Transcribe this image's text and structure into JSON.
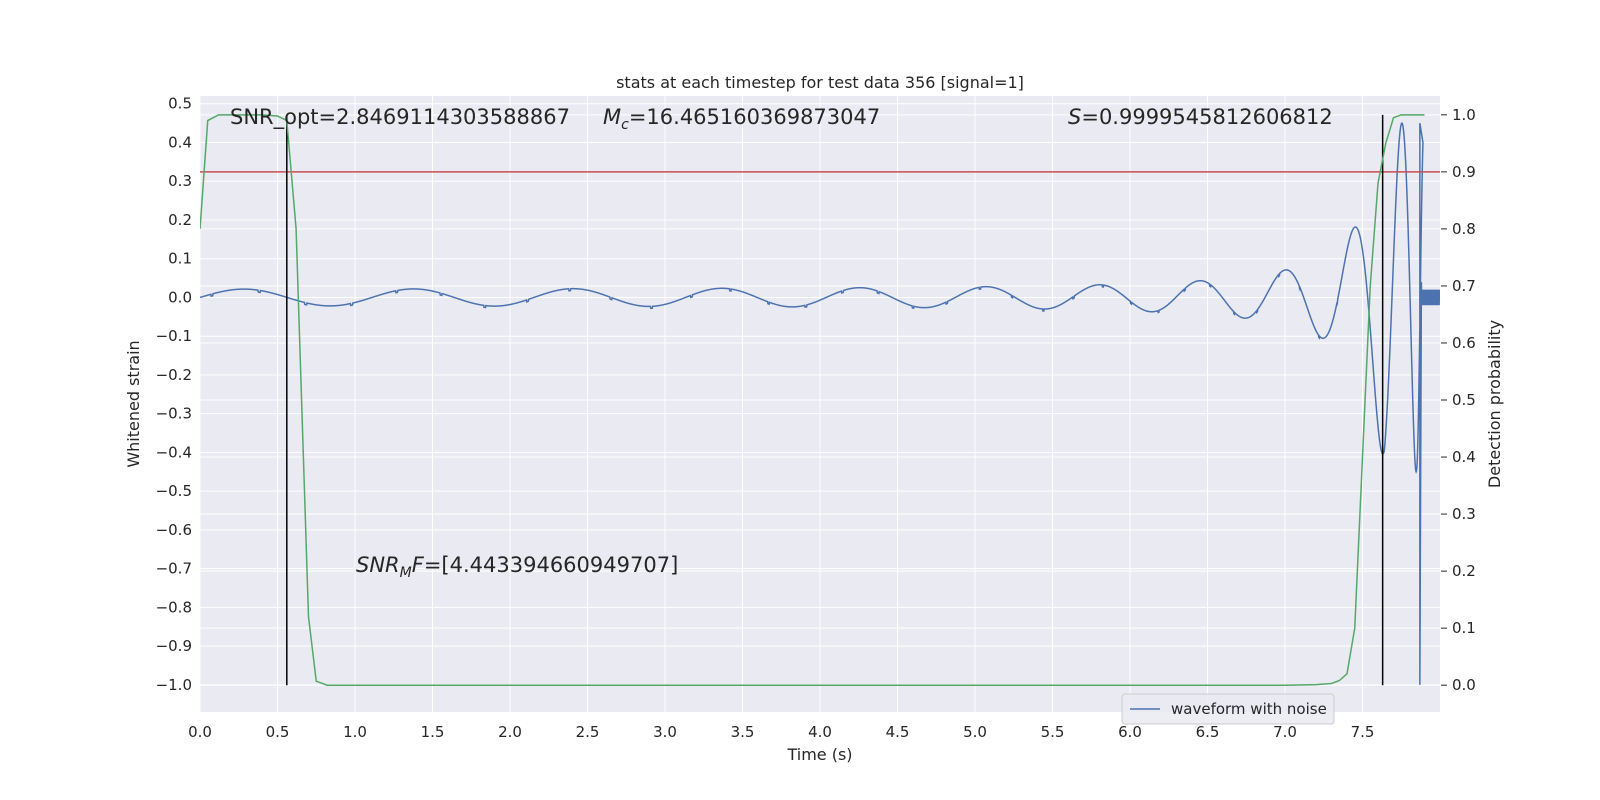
{
  "chart_data": {
    "type": "line",
    "title": "stats at each timestep for test data 356 [signal=1]",
    "xlabel": "Time (s)",
    "ylabel": "Whitened strain",
    "y2label": "Detection probability",
    "xlim": [
      0.0,
      8.0
    ],
    "ylim": [
      -1.07,
      0.52
    ],
    "y2lim": [
      -0.047,
      1.033
    ],
    "xticks": [
      "0.0",
      "0.5",
      "1.0",
      "1.5",
      "2.0",
      "2.5",
      "3.0",
      "3.5",
      "4.0",
      "4.5",
      "5.0",
      "5.5",
      "6.0",
      "6.5",
      "7.0",
      "7.5"
    ],
    "yticks": [
      "0.5",
      "0.4",
      "0.3",
      "0.2",
      "0.1",
      "0.0",
      "−0.1",
      "−0.2",
      "−0.3",
      "−0.4",
      "−0.5",
      "−0.6",
      "−0.7",
      "−0.8",
      "−0.9",
      "−1.0"
    ],
    "y2ticks": [
      "1.0",
      "0.9",
      "0.8",
      "0.7",
      "0.6",
      "0.5",
      "0.4",
      "0.3",
      "0.2",
      "0.1",
      "0.0"
    ],
    "grid": true,
    "legend_placement": "lower-right",
    "annotations": {
      "snr_opt": "SNR_opt=2.8469114303588867",
      "mc_symbol": "M",
      "mc_sub": "c",
      "mc_value": "=16.465160369873047",
      "s_symbol": "S",
      "s_value": "=0.9999545812606812",
      "snrmf_symbol": "SNR",
      "snrmf_sub": "M",
      "snrmf_tail": "F",
      "snrmf_value": "=[4.443394660949707]"
    },
    "series": [
      {
        "name": "waveform with noise",
        "axis": "left",
        "color": "#4c72b0",
        "kind": "chirp",
        "t_start": 0.0,
        "t_end": 7.89,
        "merger_time": 7.87,
        "early_amplitude": 0.02,
        "peak_amplitude": 0.45,
        "end_min": -1.0
      },
      {
        "axis": "right",
        "color": "#55a868",
        "x": [
          0.0,
          0.05,
          0.12,
          0.2,
          0.3,
          0.4,
          0.5,
          0.56,
          0.62,
          0.7,
          0.75,
          0.82,
          1.0,
          2.0,
          3.0,
          4.0,
          5.0,
          6.0,
          7.0,
          7.2,
          7.3,
          7.35,
          7.4,
          7.45,
          7.5,
          7.55,
          7.6,
          7.65,
          7.7,
          7.75,
          7.8,
          7.9
        ],
        "values": [
          0.8,
          0.99,
          1.0,
          1.0,
          1.0,
          1.0,
          0.998,
          0.99,
          0.8,
          0.12,
          0.007,
          0.0,
          0.0,
          0.0,
          0.0,
          0.0,
          0.0,
          0.0,
          0.0,
          0.001,
          0.003,
          0.008,
          0.02,
          0.1,
          0.4,
          0.7,
          0.88,
          0.95,
          0.995,
          1.0,
          1.0,
          1.0
        ]
      }
    ],
    "hlines": [
      {
        "axis": "right",
        "value": 0.9,
        "color": "#c44e52"
      }
    ],
    "vlines": [
      {
        "x": 0.56,
        "ymin": 0.0,
        "ymax": 1.0,
        "color": "#000000"
      },
      {
        "x": 7.63,
        "ymin": 0.0,
        "ymax": 1.0,
        "color": "#000000"
      }
    ]
  }
}
